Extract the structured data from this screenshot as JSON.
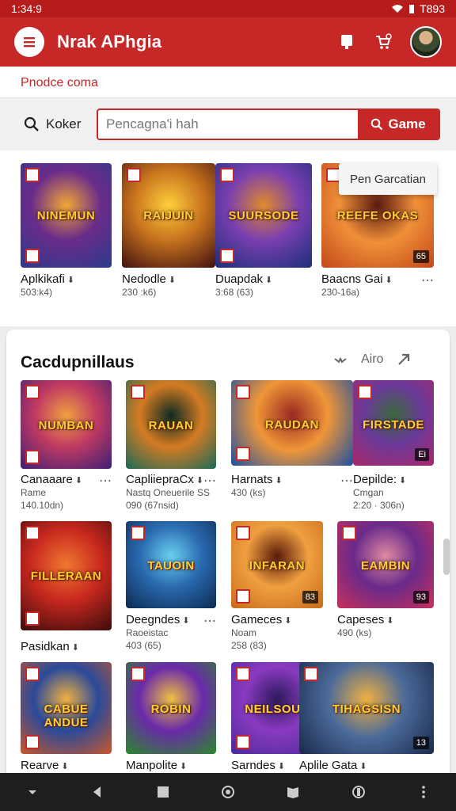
{
  "status_bar": {
    "time": "1:34:9",
    "right_text": "T893"
  },
  "app_bar": {
    "title": "Nrak APhgia",
    "icons": [
      "menu-icon",
      "bookmark-icon",
      "cart-icon",
      "avatar"
    ]
  },
  "subheader": {
    "label": "Pnodce coma"
  },
  "search": {
    "label": "Koker",
    "placeholder": "Pencagna'i hah",
    "button_label": "Game"
  },
  "tooltip": "Pen Garcatian",
  "top_row": [
    {
      "art": "NINEMUN",
      "name": "Aplkikafi",
      "sub": "503:k4)",
      "colors": [
        "#2b3a8c",
        "#6a2c8a",
        "#f2a634"
      ]
    },
    {
      "art": "RAIJUIN",
      "name": "Nedodle",
      "sub": "230 :k6)",
      "colors": [
        "#401010",
        "#c8741e",
        "#ffce3a"
      ]
    },
    {
      "art": "SUURSODE",
      "name": "Duapdak",
      "sub": "3:68 (63)",
      "colors": [
        "#1a2f7a",
        "#7a3fb0",
        "#e08a2a"
      ]
    },
    {
      "art": "REEFE OKAS",
      "name": "Baacns Gai",
      "sub": "230-16a)",
      "colors": [
        "#c2471b",
        "#f09038",
        "#5a1a10"
      ]
    }
  ],
  "section": {
    "title": "Cacdupnillaus",
    "action_label": "Airo"
  },
  "grid": [
    {
      "art": "NUMBAN",
      "name": "Canaaare",
      "line2": "Rame",
      "sub": "140.10dn)",
      "colors": [
        "#3b1f74",
        "#c03a62",
        "#f0a040"
      ]
    },
    {
      "art": "RAUAN",
      "name": "CapliiepraCx",
      "line2": "Nastq Oneuerile SS",
      "sub": "090 (67nsid)",
      "colors": [
        "#1a6a56",
        "#d47b22",
        "#0c2a22"
      ]
    },
    {
      "art": "RAUDAN",
      "name": "Harnats",
      "sub": "430 (ks)",
      "colors": [
        "#1c4fa0",
        "#f09638",
        "#9a2a20"
      ]
    },
    {
      "art": "FIRSTADE",
      "name": "Depilde:",
      "line2": "Cmgan",
      "sub": "2:20 · 306n)",
      "colors": [
        "#a8286a",
        "#6a3a9a",
        "#3a6a3a"
      ]
    },
    {
      "art": "FILLERAAN",
      "name": "Pasidkan",
      "sub": "",
      "colors": [
        "#3a0c0c",
        "#c8281e",
        "#f07830"
      ]
    },
    {
      "art": "TAUOIN",
      "name": "Deegndes",
      "line2": "Raoeistac",
      "sub": "403 (65)",
      "colors": [
        "#0c2a50",
        "#2a6ab0",
        "#6ad0f0"
      ]
    },
    {
      "art": "INFARAN",
      "name": "Gameces",
      "line2": "Noam",
      "sub": "258 (83)",
      "colors": [
        "#c86a1a",
        "#f0a040",
        "#5a1a08"
      ]
    },
    {
      "art": "EAMBIN",
      "name": "Capeses",
      "sub": "490 (ks)",
      "colors": [
        "#c8305a",
        "#6a2a8a",
        "#e08aa0"
      ]
    },
    {
      "art": "CABUE ANDUE",
      "name": "Rearve",
      "sub": "",
      "colors": [
        "#c8582a",
        "#2a4a9a",
        "#f0b040"
      ]
    },
    {
      "art": "ROBIN",
      "name": "Manpolite",
      "sub": "",
      "colors": [
        "#2a8a2a",
        "#6a2aaa",
        "#f0c040"
      ]
    },
    {
      "art": "NEILSOUK",
      "name": "Sarndes",
      "sub": "",
      "colors": [
        "#4a2a9a",
        "#8a3ac0",
        "#2a1a5a"
      ]
    },
    {
      "art": "TIHAGSISN",
      "name": "Aplile Gata",
      "sub": "",
      "colors": [
        "#1a2a4a",
        "#4a6a9a",
        "#f0b040"
      ]
    }
  ],
  "ratings": [
    "65",
    "Ei",
    "93",
    "83",
    "13"
  ],
  "nav_icons": [
    "down-caret-icon",
    "back-icon",
    "home-icon",
    "circle-icon",
    "book-icon",
    "app-icon",
    "more-icon"
  ]
}
